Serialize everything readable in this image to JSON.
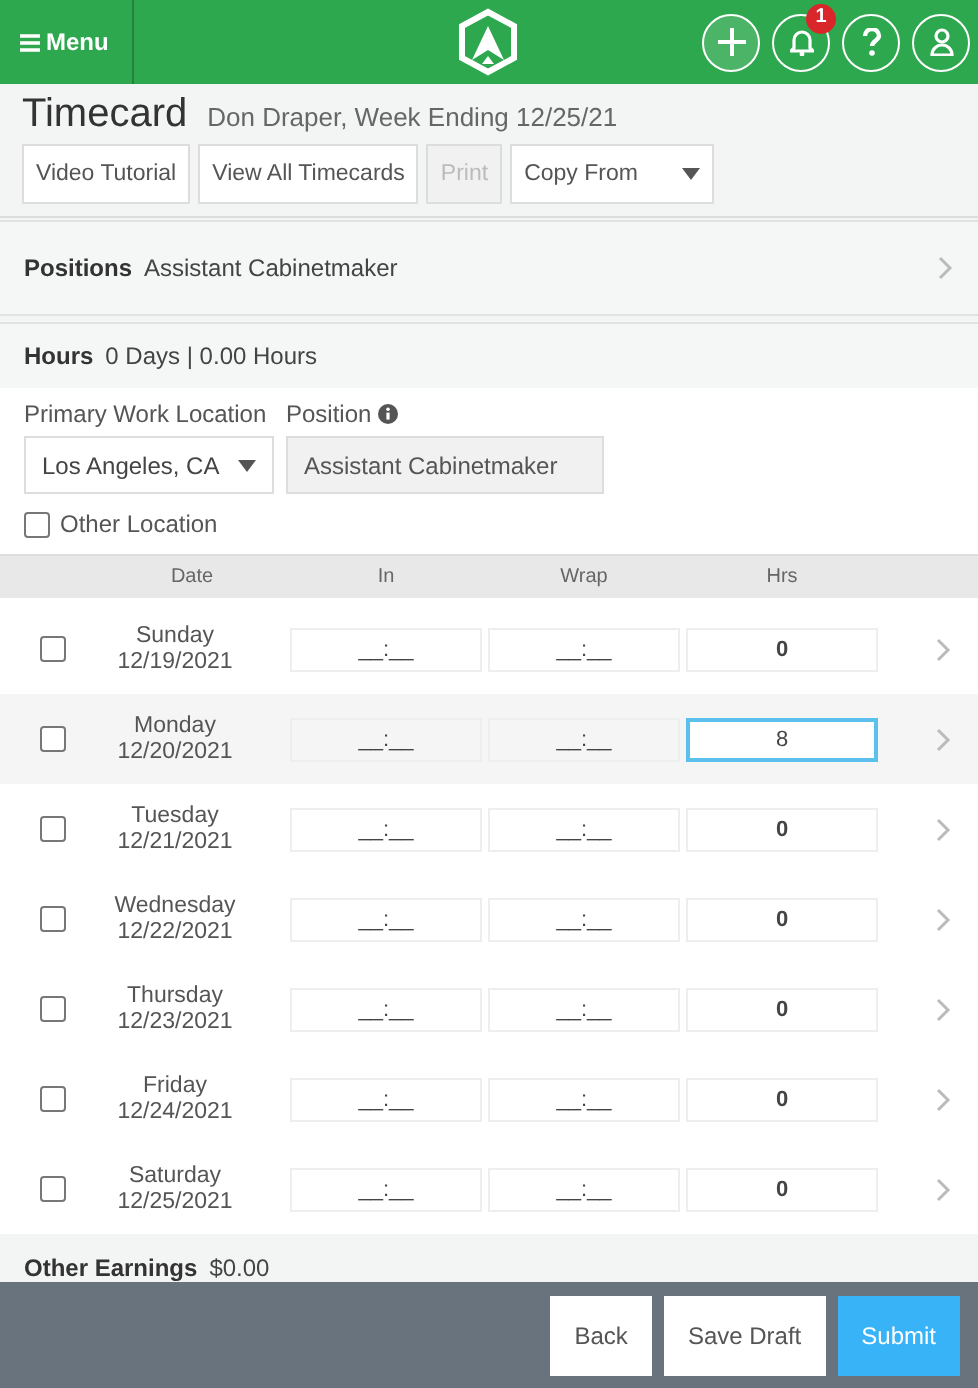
{
  "header": {
    "menu_label": "Menu",
    "notification_count": "1"
  },
  "title": "Timecard",
  "subtitle": "Don Draper, Week Ending 12/25/21",
  "toolbar": [
    {
      "label": "Video Tutorial",
      "disabled": false,
      "kind": "button"
    },
    {
      "label": "View All Timecards",
      "disabled": false,
      "kind": "button"
    },
    {
      "label": "Print",
      "disabled": true,
      "kind": "button"
    },
    {
      "label": "Copy From",
      "disabled": false,
      "kind": "dropdown"
    }
  ],
  "positions": {
    "label": "Positions",
    "value": "Assistant Cabinetmaker"
  },
  "hours": {
    "label": "Hours",
    "summary": "0 Days | 0.00 Hours"
  },
  "work_location": {
    "label": "Primary Work Location",
    "value": "Los Angeles, CA"
  },
  "position": {
    "label": "Position",
    "value": "Assistant Cabinetmaker"
  },
  "other_location": {
    "label": "Other Location",
    "checked": false
  },
  "table": {
    "columns": [
      "Date",
      "In",
      "Wrap",
      "Hrs"
    ],
    "rows": [
      {
        "day": "Sunday",
        "date": "12/19/2021",
        "in": "__:__",
        "wrap": "__:__",
        "hrs": "0",
        "checked": false,
        "selected": false
      },
      {
        "day": "Monday",
        "date": "12/20/2021",
        "in": "__:__",
        "wrap": "__:__",
        "hrs": "8",
        "checked": false,
        "selected": true
      },
      {
        "day": "Tuesday",
        "date": "12/21/2021",
        "in": "__:__",
        "wrap": "__:__",
        "hrs": "0",
        "checked": false,
        "selected": false
      },
      {
        "day": "Wednesday",
        "date": "12/22/2021",
        "in": "__:__",
        "wrap": "__:__",
        "hrs": "0",
        "checked": false,
        "selected": false
      },
      {
        "day": "Thursday",
        "date": "12/23/2021",
        "in": "__:__",
        "wrap": "__:__",
        "hrs": "0",
        "checked": false,
        "selected": false
      },
      {
        "day": "Friday",
        "date": "12/24/2021",
        "in": "__:__",
        "wrap": "__:__",
        "hrs": "0",
        "checked": false,
        "selected": false
      },
      {
        "day": "Saturday",
        "date": "12/25/2021",
        "in": "__:__",
        "wrap": "__:__",
        "hrs": "0",
        "checked": false,
        "selected": false
      }
    ]
  },
  "other_earnings": {
    "label": "Other Earnings",
    "value": "$0.00"
  },
  "footer_buttons": [
    {
      "label": "Back",
      "kind": "secondary"
    },
    {
      "label": "Save Draft",
      "kind": "secondary"
    },
    {
      "label": "Submit",
      "kind": "primary"
    }
  ]
}
